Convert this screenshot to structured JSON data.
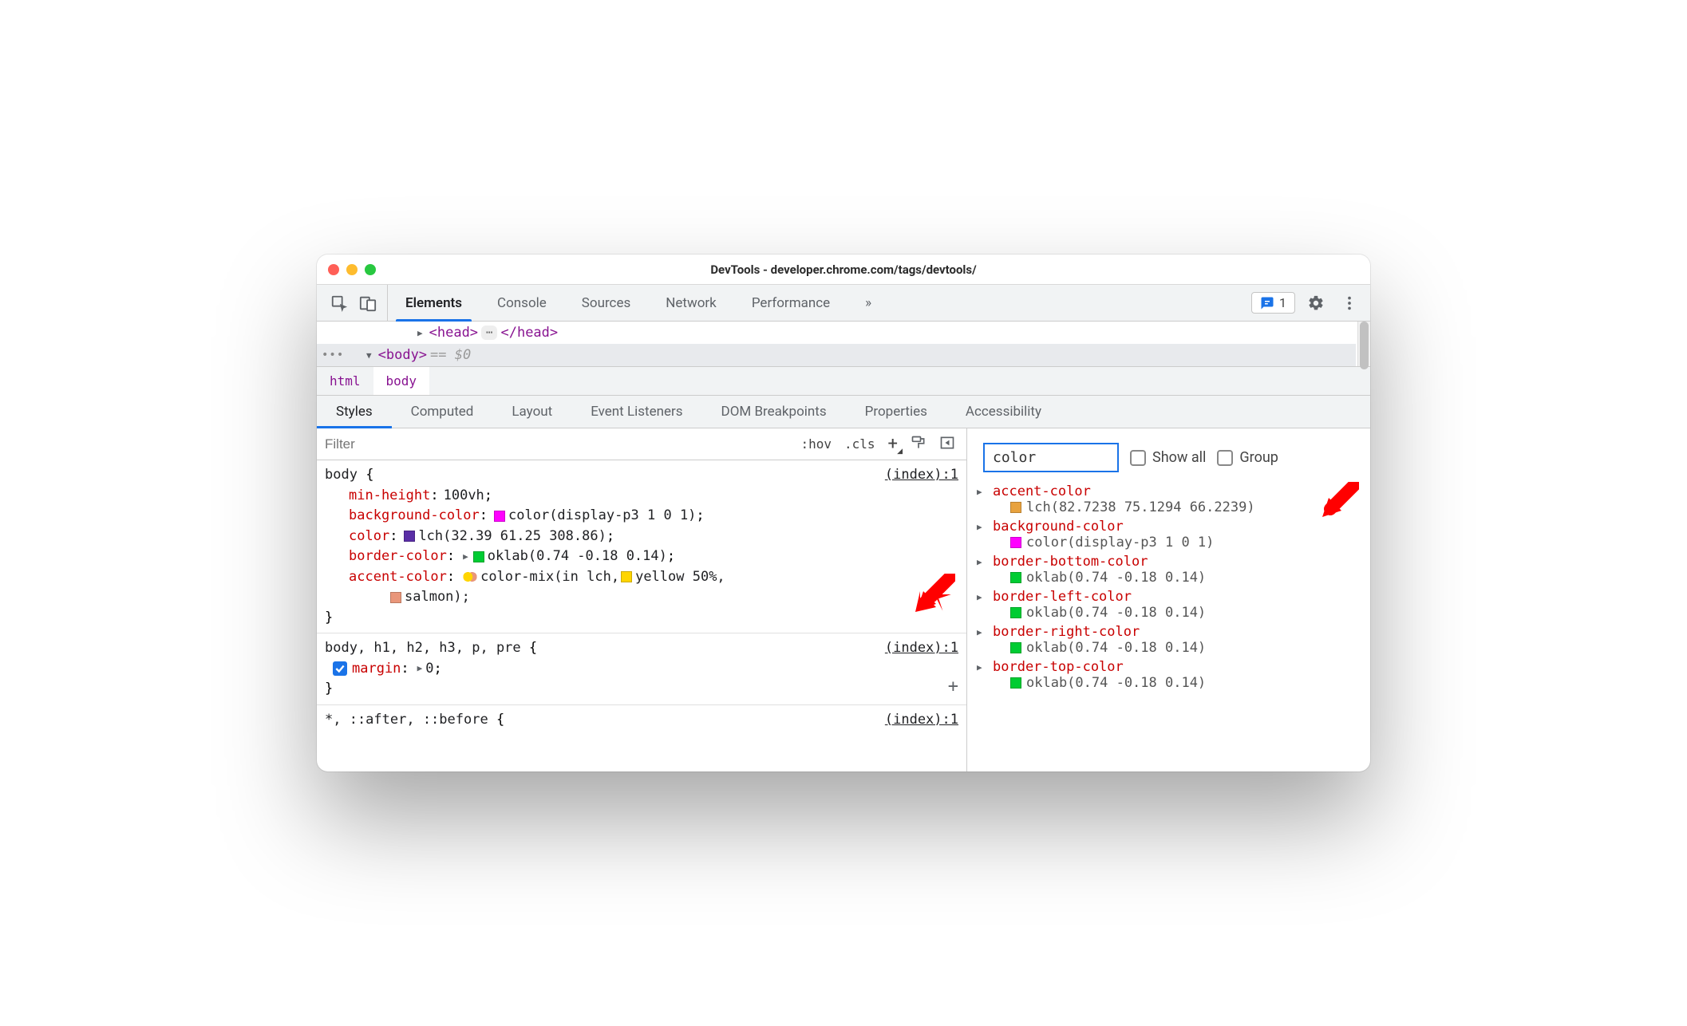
{
  "window": {
    "title": "DevTools - developer.chrome.com/tags/devtools/"
  },
  "mainTabs": {
    "items": [
      "Elements",
      "Console",
      "Sources",
      "Network",
      "Performance"
    ],
    "more": "»",
    "active": "Elements"
  },
  "issues": {
    "count": "1"
  },
  "dom": {
    "head_open": "<head>",
    "head_close": "</head>",
    "body_open": "<body>",
    "selected_hint": "== $0"
  },
  "breadcrumb": [
    "html",
    "body"
  ],
  "panelTabs": [
    "Styles",
    "Computed",
    "Layout",
    "Event Listeners",
    "DOM Breakpoints",
    "Properties",
    "Accessibility"
  ],
  "panelActive": "Styles",
  "stylesFilter": {
    "placeholder": "Filter"
  },
  "stylesActions": {
    "hov": ":hov",
    "cls": ".cls",
    "plus_tooltip": "New Style Rule"
  },
  "rules": [
    {
      "selector": "body",
      "dim": "",
      "source": "(index):1",
      "decls": [
        {
          "prop": "min-height",
          "value": "100vh"
        },
        {
          "prop": "background-color",
          "swatch": "sw-magenta",
          "value": "color(display-p3 1 0 1)"
        },
        {
          "prop": "color",
          "swatch": "sw-purple",
          "value": "lch(32.39 61.25 308.86)"
        },
        {
          "prop": "border-color",
          "expand": true,
          "swatch": "sw-greenbright",
          "value": "oklab(0.74 -0.18 0.14)"
        },
        {
          "prop": "accent-color",
          "colormix": true,
          "value_prefix": "color-mix(in lch, ",
          "yellow_label": "yellow 50%,",
          "salmon_label": "salmon);"
        }
      ]
    },
    {
      "selector": "body",
      "dim": ", h1, h2, h3, p, pre",
      "source": "(index):1",
      "decls": [
        {
          "prop": "margin",
          "checked": true,
          "expand": true,
          "value": "0"
        }
      ]
    },
    {
      "selector": "",
      "dim": "*, ::after, ::before",
      "source": "(index):1",
      "decls": []
    }
  ],
  "computedFilter": {
    "value": "color"
  },
  "computedOptions": {
    "showAll": "Show all",
    "group": "Group"
  },
  "computed": [
    {
      "name": "accent-color",
      "swatch": "sw-orange",
      "value": "lch(82.7238 75.1294 66.2239)"
    },
    {
      "name": "background-color",
      "swatch": "sw-magenta",
      "value": "color(display-p3 1 0 1)"
    },
    {
      "name": "border-bottom-color",
      "swatch": "sw-greenbright",
      "value": "oklab(0.74 -0.18 0.14)"
    },
    {
      "name": "border-left-color",
      "swatch": "sw-greenbright",
      "value": "oklab(0.74 -0.18 0.14)"
    },
    {
      "name": "border-right-color",
      "swatch": "sw-greenbright",
      "value": "oklab(0.74 -0.18 0.14)"
    },
    {
      "name": "border-top-color",
      "swatch": "sw-greenbright",
      "value": "oklab(0.74 -0.18 0.14)"
    }
  ]
}
